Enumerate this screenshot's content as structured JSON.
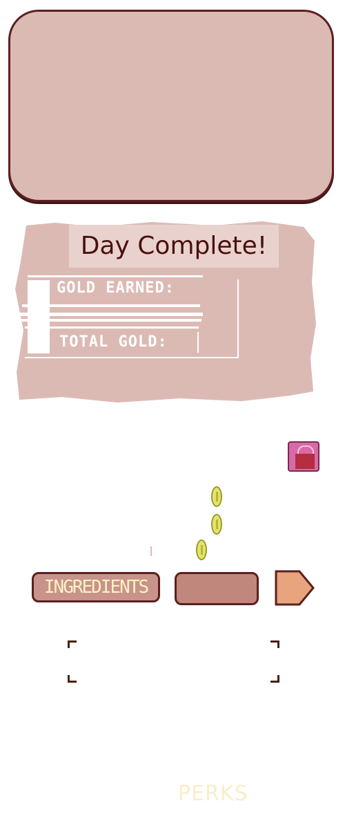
{
  "day_panel": {
    "title": "Day Complete!",
    "gold_earned_label": "GOLD EARNED:",
    "total_gold_label": "TOTAL GOLD:"
  },
  "tabs": {
    "ingredients_label": "INGREDIENTS"
  },
  "footer": {
    "perks_label": "PERKS"
  },
  "icons": {
    "bag": "shopping-bag-icon",
    "coin": "gold-coin-icon",
    "next": "arrow-right-icon"
  },
  "colors": {
    "panel": "#dcbab4",
    "panel_border": "#5c1f1f",
    "accent_pink": "#d86aa8",
    "arrow": "#e8a47c",
    "coin": "#e6e36a"
  }
}
